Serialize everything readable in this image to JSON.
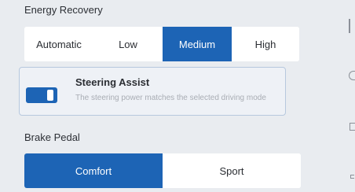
{
  "energy_recovery": {
    "label": "Energy Recovery",
    "options": [
      "Automatic",
      "Low",
      "Medium",
      "High"
    ],
    "selected": "Medium"
  },
  "steering_assist": {
    "title": "Steering Assist",
    "description": "The steering power matches the selected driving mode",
    "enabled": true
  },
  "brake_pedal": {
    "label": "Brake Pedal",
    "options": [
      "Comfort",
      "Sport"
    ],
    "selected": "Comfort"
  },
  "colors": {
    "accent": "#1d64b5",
    "background": "#e9ecf0",
    "card_border": "#b7c8de"
  },
  "side_icons": [
    "bar-icon",
    "circle-icon",
    "square-icon",
    "small-square-icon"
  ]
}
